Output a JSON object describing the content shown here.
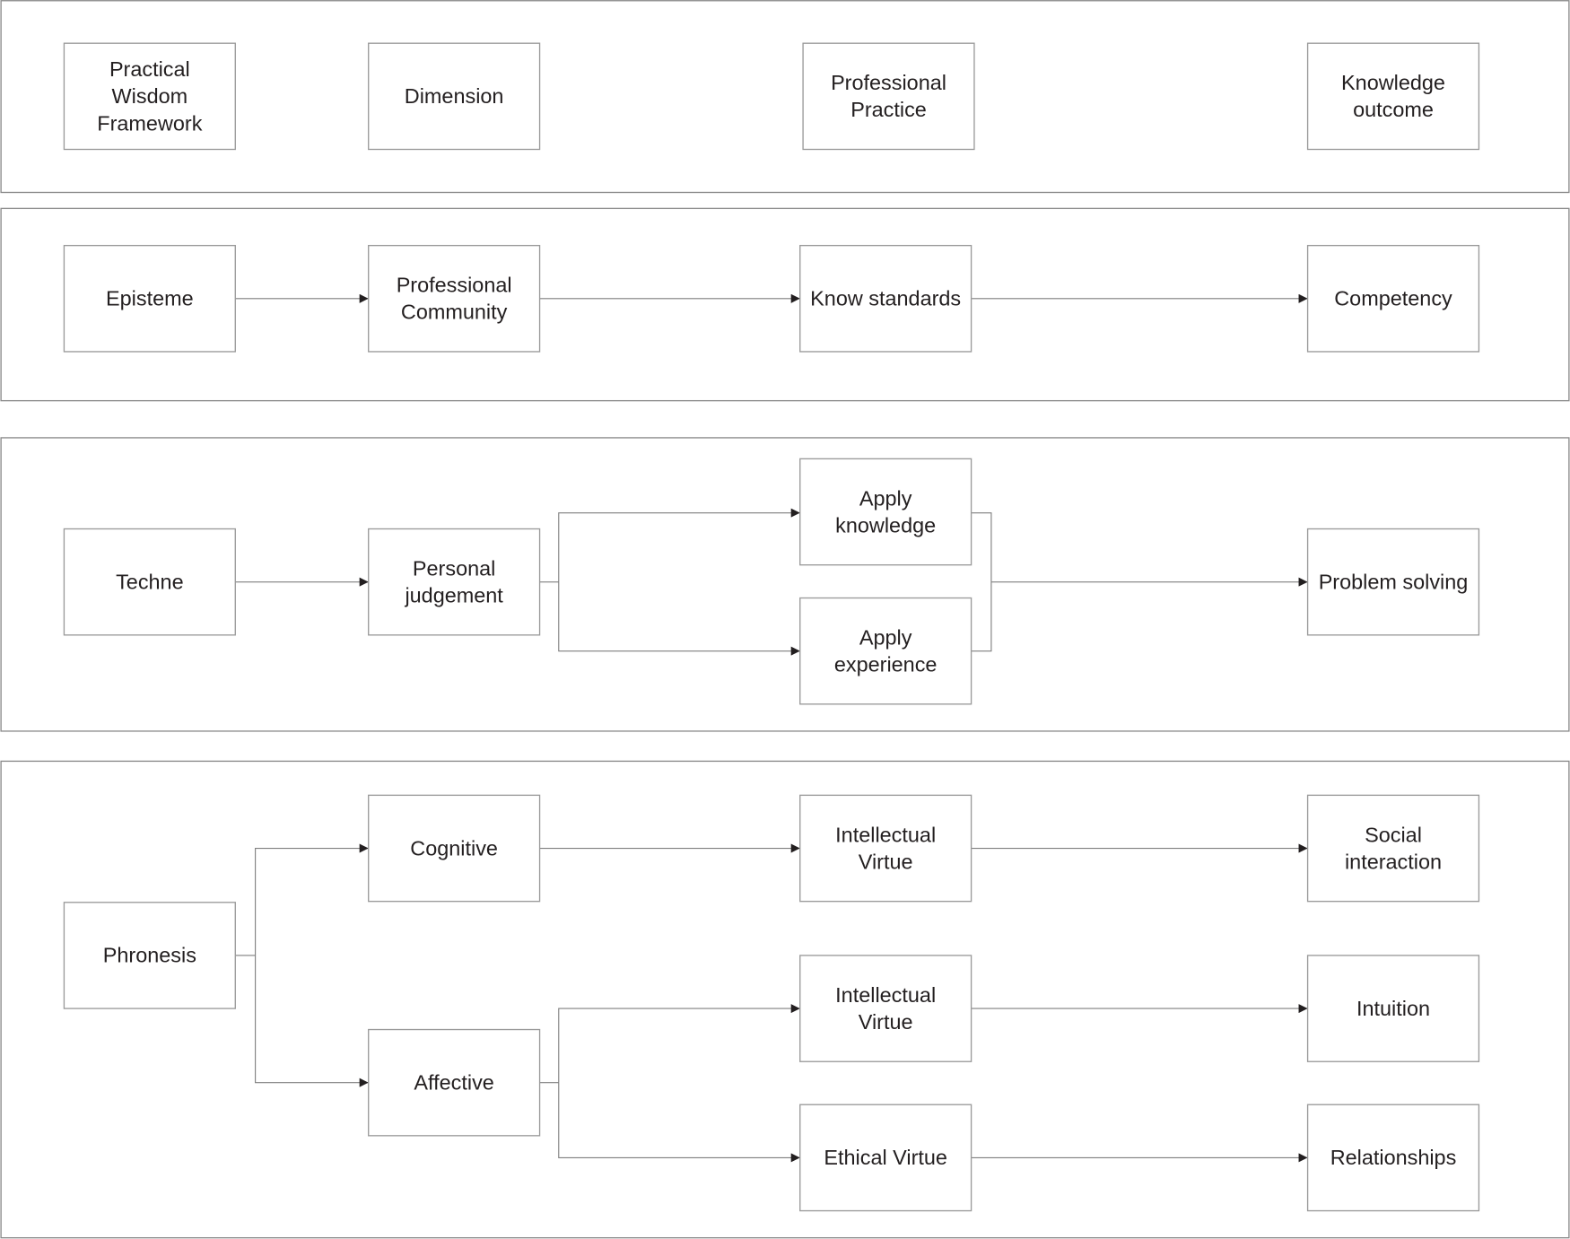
{
  "diagram": {
    "title": "Practical Wisdom Framework",
    "header_row": {
      "cells": [
        {
          "id": "h1",
          "lines": [
            "Practical",
            "Wisdom",
            "Framework"
          ]
        },
        {
          "id": "h2",
          "lines": [
            "Dimension"
          ]
        },
        {
          "id": "h3",
          "lines": [
            "Professional",
            "Practice"
          ]
        },
        {
          "id": "h4",
          "lines": [
            "Knowledge",
            "outcome"
          ]
        }
      ]
    },
    "panels": [
      {
        "name": "episteme",
        "nodes": [
          {
            "id": "episteme",
            "lines": [
              "Episteme"
            ]
          },
          {
            "id": "prof_community",
            "lines": [
              "Professional",
              "Community"
            ]
          },
          {
            "id": "know_standards",
            "lines": [
              "Know standards"
            ]
          },
          {
            "id": "competency",
            "lines": [
              "Competency"
            ]
          }
        ],
        "edges": [
          [
            "episteme",
            "prof_community"
          ],
          [
            "prof_community",
            "know_standards"
          ],
          [
            "know_standards",
            "competency"
          ]
        ]
      },
      {
        "name": "techne",
        "nodes": [
          {
            "id": "techne",
            "lines": [
              "Techne"
            ]
          },
          {
            "id": "personal_judgement",
            "lines": [
              "Personal",
              "judgement"
            ]
          },
          {
            "id": "apply_knowledge",
            "lines": [
              "Apply",
              "knowledge"
            ]
          },
          {
            "id": "apply_experience",
            "lines": [
              "Apply",
              "experience"
            ]
          },
          {
            "id": "problem_solving",
            "lines": [
              "Problem solving"
            ]
          }
        ],
        "edges": [
          [
            "techne",
            "personal_judgement"
          ],
          [
            "personal_judgement",
            "apply_knowledge"
          ],
          [
            "personal_judgement",
            "apply_experience"
          ],
          [
            "apply_knowledge",
            "problem_solving"
          ],
          [
            "apply_experience",
            "problem_solving"
          ]
        ]
      },
      {
        "name": "phronesis",
        "nodes": [
          {
            "id": "phronesis",
            "lines": [
              "Phronesis"
            ]
          },
          {
            "id": "cognitive",
            "lines": [
              "Cognitive"
            ]
          },
          {
            "id": "affective",
            "lines": [
              "Affective"
            ]
          },
          {
            "id": "intellectual_virtue_1",
            "lines": [
              "Intellectual",
              "Virtue"
            ]
          },
          {
            "id": "intellectual_virtue_2",
            "lines": [
              "Intellectual",
              "Virtue"
            ]
          },
          {
            "id": "ethical_virtue",
            "lines": [
              "Ethical Virtue"
            ]
          },
          {
            "id": "social_interaction",
            "lines": [
              "Social",
              "interaction"
            ]
          },
          {
            "id": "intuition",
            "lines": [
              "Intuition"
            ]
          },
          {
            "id": "relationships",
            "lines": [
              "Relationships"
            ]
          }
        ],
        "edges": [
          [
            "phronesis",
            "cognitive"
          ],
          [
            "phronesis",
            "affective"
          ],
          [
            "cognitive",
            "intellectual_virtue_1"
          ],
          [
            "affective",
            "intellectual_virtue_2"
          ],
          [
            "affective",
            "ethical_virtue"
          ],
          [
            "intellectual_virtue_1",
            "social_interaction"
          ],
          [
            "intellectual_virtue_2",
            "intuition"
          ],
          [
            "ethical_virtue",
            "relationships"
          ]
        ]
      }
    ]
  },
  "colors": {
    "line": "#7f7f7f",
    "box_border": "#9a9a9a",
    "text": "#231f20",
    "arrow": "#231f20"
  }
}
